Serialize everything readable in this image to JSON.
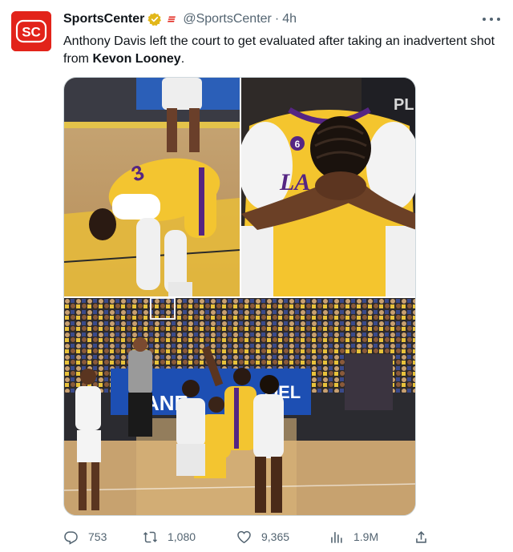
{
  "tweet": {
    "avatar_text": "SC",
    "display_name": "SportsCenter",
    "handle": "@SportsCenter",
    "separator": "·",
    "time": "4h",
    "text_before": "Anthony Davis left the court to get evaluated after taking an inadvertent shot from ",
    "text_bold": "Kevon Looney",
    "text_after": ".",
    "verified_icon": "verified-badge-gold",
    "affiliate_icon": "espn-affiliate-badge",
    "more_icon": "more-dots",
    "photos": [
      {
        "id": "photo-1",
        "jersey_text": "3"
      },
      {
        "id": "photo-2",
        "jersey_text": "LA",
        "number": "6"
      },
      {
        "id": "photo-3",
        "banner_left": "ANE",
        "banner_right": "OEL"
      }
    ],
    "metrics": {
      "replies": "753",
      "retweets": "1,080",
      "likes": "9,365",
      "views": "1.9M"
    },
    "colors": {
      "brand_red": "#e2231a",
      "lakers_gold": "#f5c42c",
      "lakers_purple": "#552583",
      "warriors_blue": "#1d428a",
      "text_secondary": "#536471",
      "verified_gold": "#e2b719"
    }
  }
}
